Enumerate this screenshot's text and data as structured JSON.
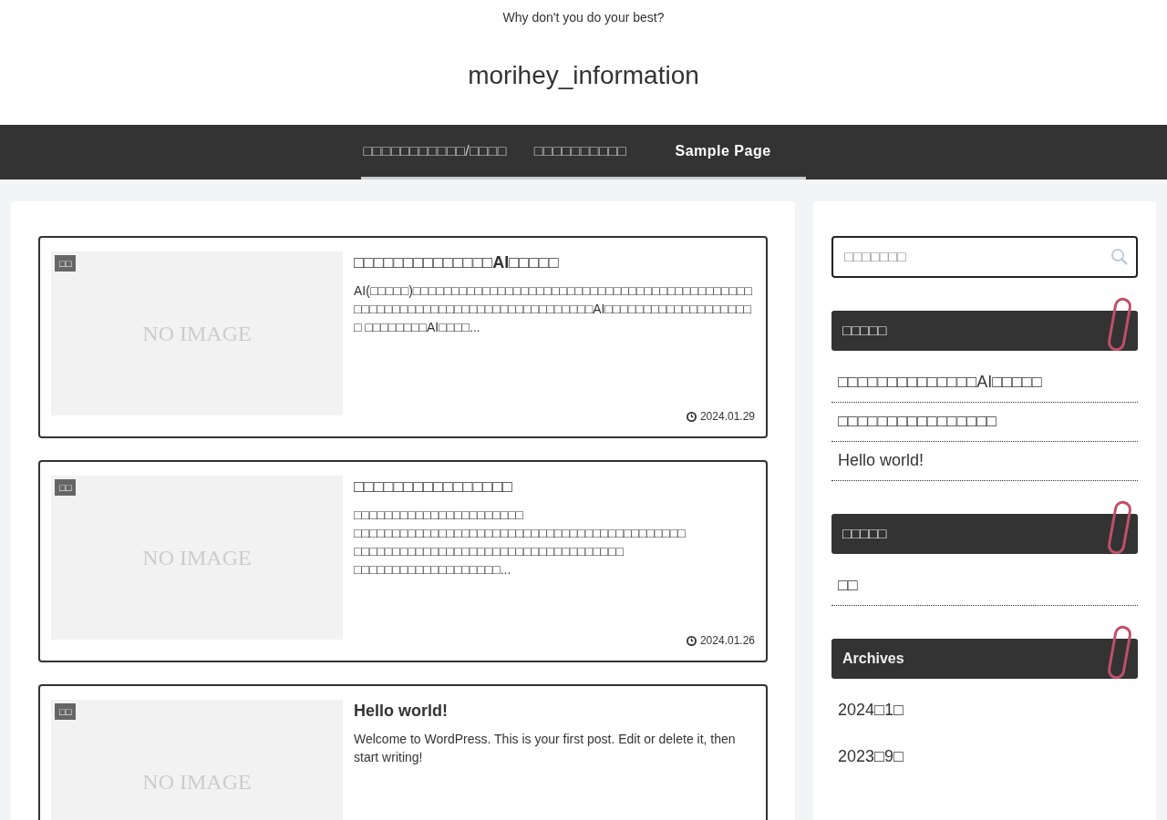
{
  "header": {
    "tagline": "Why don't you do your best?",
    "site_title": "morihey_information"
  },
  "nav": [
    {
      "label": "□□□□□□□□□□□/□□□□",
      "selected": false
    },
    {
      "label": "□□□□□□□□□□",
      "selected": false
    },
    {
      "label": "Sample Page",
      "selected": true
    }
  ],
  "posts": [
    {
      "category": "□□",
      "thumbnail": "NO IMAGE",
      "title": "□□□□□□□□□□□□□□AI□□□□□",
      "excerpt": "AI(□□□□□)□□□□□□□□□□□□□□□□□□□□□□□□□□□□□□□□□□□□□□□□□□□□□□□□□□□□□□□□□□□□□□□□□□□□□□□□□□□AI□□□□□□□□□□□□□□□□□□□□ □□□□□□□□AI□□□□...",
      "date": "2024.01.29"
    },
    {
      "category": "□□",
      "thumbnail": "NO IMAGE",
      "title": "□□□□□□□□□□□□□□□□",
      "excerpt": "□□□□□□□□□□□□□□□□□□□□□□ □□□□□□□□□□□□□□□□□□□□□□□□□□□□□□□□□□□□□□□□□□□ □□□□□□□□□□□□□□□□□□□□□□□□□□□□□□□□□□□   □□□□□□□□□□□□□□□□□□□...",
      "date": "2024.01.26"
    },
    {
      "category": "□□",
      "thumbnail": "NO IMAGE",
      "title": "Hello world!",
      "excerpt": "Welcome to WordPress. This is your first post. Edit or delete it, then start writing!"
    }
  ],
  "sidebar": {
    "search": {
      "placeholder": "□□□□□□□"
    },
    "widgets": [
      {
        "title": "□□□□□",
        "items": [
          "□□□□□□□□□□□□□□AI□□□□□",
          "□□□□□□□□□□□□□□□□",
          "Hello world!"
        ],
        "kind": "list"
      },
      {
        "title": "□□□□□",
        "items": [
          "□□"
        ],
        "kind": "list"
      },
      {
        "title": "Archives",
        "items": [
          "2024□1□",
          "2023□9□"
        ],
        "kind": "plain"
      }
    ]
  }
}
